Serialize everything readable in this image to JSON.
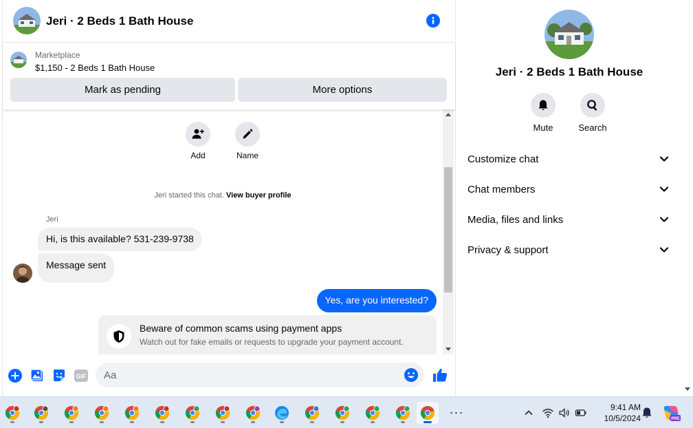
{
  "chat": {
    "title": "Jeri · 2 Beds 1 Bath House",
    "listing": {
      "category": "Marketplace",
      "price_title": "$1,150 - 2 Beds 1 Bath House",
      "pending_label": "Mark as pending",
      "more_label": "More options"
    },
    "actions": {
      "add_label": "Add",
      "name_label": "Name"
    },
    "started_text": "Jeri started this chat.",
    "buyer_profile_link": "View buyer profile",
    "sender_name": "Jeri",
    "messages": [
      {
        "text": "Hi, is this available? 531-239-9738",
        "direction": "incoming"
      },
      {
        "text": "Message sent",
        "direction": "incoming"
      },
      {
        "text": "Yes, are you interested?",
        "direction": "outgoing"
      }
    ],
    "scam_notice": {
      "title": "Beware of common scams using payment apps",
      "text": "Watch out for fake emails or requests to upgrade your payment account."
    },
    "composer": {
      "placeholder": "Aa",
      "value": ""
    }
  },
  "panel": {
    "title": "Jeri · 2 Beds 1 Bath House",
    "mute_label": "Mute",
    "search_label": "Search",
    "sections": [
      "Customize chat",
      "Chat members",
      "Media, files and links",
      "Privacy & support"
    ]
  },
  "taskbar": {
    "time": "9:41 AM",
    "date": "10/5/2024",
    "more_label": "···",
    "copilot_badge": "PRE"
  },
  "colors": {
    "accent": "#0866ff",
    "bubble_in": "#f0f0f0",
    "button_gray": "#e4e6eb",
    "taskbar": "#dfe8f3"
  }
}
